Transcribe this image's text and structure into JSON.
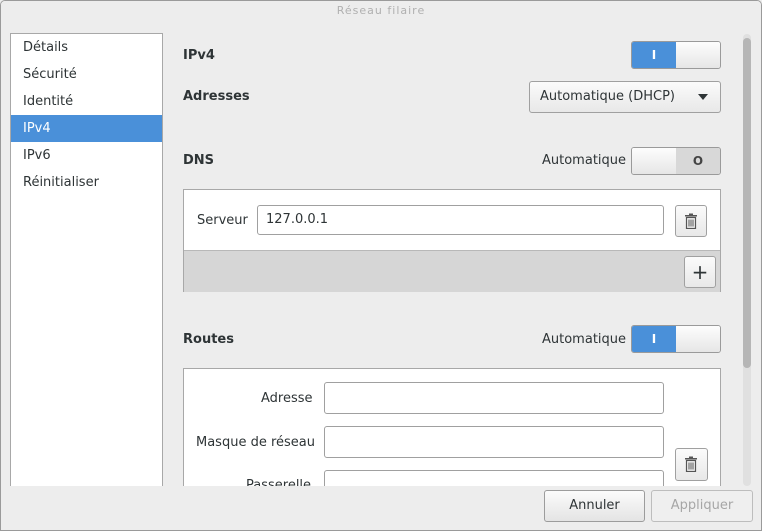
{
  "window": {
    "title": "Réseau filaire"
  },
  "sidebar": {
    "items": [
      {
        "label": "Détails"
      },
      {
        "label": "Sécurité"
      },
      {
        "label": "Identité"
      },
      {
        "label": "IPv4",
        "selected": true
      },
      {
        "label": "IPv6"
      },
      {
        "label": "Réinitialiser"
      }
    ]
  },
  "ipv4": {
    "label": "IPv4",
    "switch_on": "I"
  },
  "addresses": {
    "label": "Adresses",
    "selected": "Automatique (DHCP)"
  },
  "dns": {
    "label": "DNS",
    "auto_label": "Automatique",
    "switch_off": "O",
    "server_label": "Serveur",
    "server_value": "127.0.0.1",
    "add_label": "+"
  },
  "routes": {
    "label": "Routes",
    "auto_label": "Automatique",
    "switch_on": "I",
    "address_label": "Adresse",
    "netmask_label": "Masque de réseau",
    "gateway_label": "Passerelle"
  },
  "footer": {
    "cancel": "Annuler",
    "apply": "Appliquer"
  },
  "colors": {
    "accent": "#4a90d9"
  }
}
